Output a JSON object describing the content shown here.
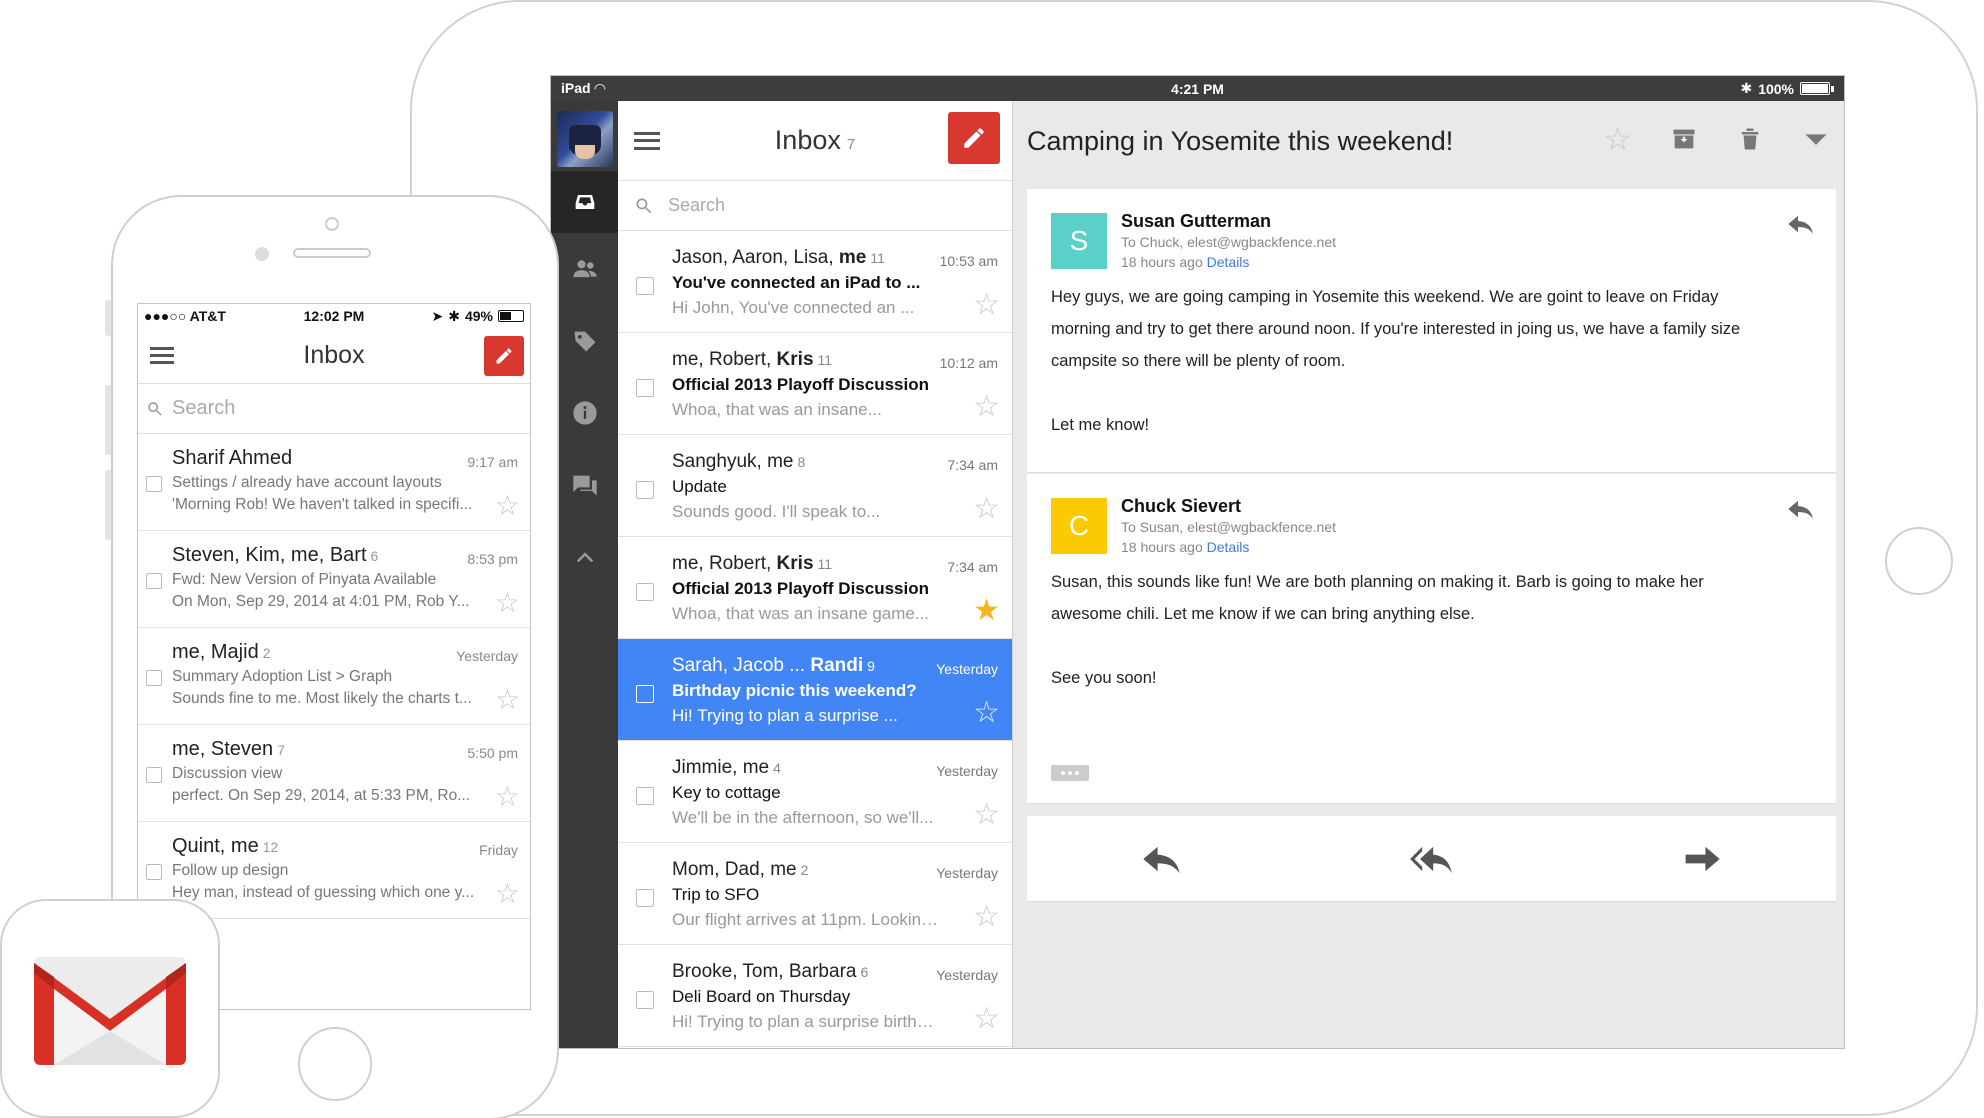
{
  "ipad": {
    "status": {
      "device": "iPad",
      "time": "4:21 PM",
      "battery": "100%"
    },
    "list": {
      "title": "Inbox",
      "count": "7",
      "search_placeholder": "Search",
      "rows": [
        {
          "from_plain": "Jason, Aaron, Lisa, ",
          "from_bold": "me",
          "count": "11",
          "time": "10:53 am",
          "subject": "You've connected an iPad to ...",
          "subject_bold": true,
          "snippet": "Hi John, You've connected an ...",
          "starred": false,
          "selected": false
        },
        {
          "from_plain": "me, Robert, ",
          "from_bold": "Kris",
          "count": "11",
          "time": "10:12 am",
          "subject": "Official 2013 Playoff Discussion",
          "subject_bold": true,
          "snippet": "Whoa, that was an insane...",
          "starred": false,
          "selected": false
        },
        {
          "from_plain": "Sanghyuk, me",
          "from_bold": "",
          "count": "8",
          "time": "7:34 am",
          "subject": "Update",
          "subject_bold": false,
          "snippet": "Sounds good. I'll speak to...",
          "starred": false,
          "selected": false
        },
        {
          "from_plain": "me, Robert, ",
          "from_bold": "Kris",
          "count": "11",
          "time": "7:34 am",
          "subject": "Official 2013 Playoff Discussion",
          "subject_bold": true,
          "snippet": "Whoa, that was an insane game...",
          "starred": true,
          "selected": false
        },
        {
          "from_plain": "Sarah, Jacob ... ",
          "from_bold": "Randi",
          "count": "9",
          "time": "Yesterday",
          "subject": "Birthday picnic this weekend?",
          "subject_bold": true,
          "snippet": "Hi! Trying to plan a surprise ...",
          "starred": false,
          "selected": true
        },
        {
          "from_plain": "Jimmie, me",
          "from_bold": "",
          "count": "4",
          "time": "Yesterday",
          "subject": "Key to cottage",
          "subject_bold": false,
          "snippet": "We'll be in the afternoon, so we'll...",
          "starred": false,
          "selected": false
        },
        {
          "from_plain": "Mom, Dad, me",
          "from_bold": "",
          "count": "2",
          "time": "Yesterday",
          "subject": "Trip to SFO",
          "subject_bold": false,
          "snippet": "Our flight arrives at 11pm. Looking...",
          "starred": false,
          "selected": false
        },
        {
          "from_plain": "Brooke, Tom, Barbara",
          "from_bold": "",
          "count": "6",
          "time": "Yesterday",
          "subject": "Deli Board on Thursday",
          "subject_bold": false,
          "snippet": "Hi! Trying to plan a surprise birthday",
          "starred": false,
          "selected": false
        }
      ]
    },
    "detail": {
      "title": "Camping in Yosemite this weekend!",
      "messages": [
        {
          "initial": "S",
          "color": "#5bd0c8",
          "name": "Susan Gutterman",
          "to": "To Chuck, elest@wgbackfence.net",
          "ago": "18 hours ago",
          "details_link": "Details",
          "paragraphs": [
            "Hey guys, we are going camping in Yosemite this weekend. We are goint to leave on Friday morning and try to get there around noon. If you're interested in joing us, we have a family size campsite so there will be plenty of room.",
            "Let me know!"
          ]
        },
        {
          "initial": "C",
          "color": "#fcca03",
          "name": "Chuck Sievert",
          "to": "To Susan, elest@wgbackfence.net",
          "ago": "18 hours ago",
          "details_link": "Details",
          "paragraphs": [
            "Susan, this sounds like fun! We are both planning on making it. Barb is going to make her awesome chili. Let me know if we can bring anything else.",
            "See you soon!"
          ]
        }
      ]
    }
  },
  "iphone": {
    "status": {
      "carrier": "●●●○○ AT&T",
      "time": "12:02 PM",
      "battery": "49%"
    },
    "title": "Inbox",
    "search_placeholder": "Search",
    "rows": [
      {
        "from": "Sharif Ahmed",
        "count": "",
        "time": "9:17 am",
        "subject": "Settings / already have account layouts",
        "snippet": "'Morning Rob! We haven't talked in specifi..."
      },
      {
        "from": "Steven, Kim, me, Bart",
        "count": "6",
        "time": "8:53 pm",
        "subject": "Fwd: New Version of Pinyata Available",
        "snippet": "On Mon, Sep 29, 2014 at 4:01 PM, Rob Y..."
      },
      {
        "from": "me, Majid",
        "count": "2",
        "time": "Yesterday",
        "subject": "Summary Adoption List > Graph",
        "snippet": "Sounds fine to me. Most likely the charts t..."
      },
      {
        "from": "me, Steven",
        "count": "7",
        "time": "5:50 pm",
        "subject": "Discussion view",
        "snippet": "perfect. On Sep 29, 2014, at 5:33 PM, Ro..."
      },
      {
        "from": "Quint, me",
        "count": "12",
        "time": "Friday",
        "subject": "Follow up design",
        "snippet": "Hey man, instead of guessing which one y..."
      }
    ]
  },
  "colors": {
    "compose": "#d8382f",
    "selected_row": "#4285f4",
    "star_on": "#f2b51d",
    "link": "#3b7ddd"
  }
}
